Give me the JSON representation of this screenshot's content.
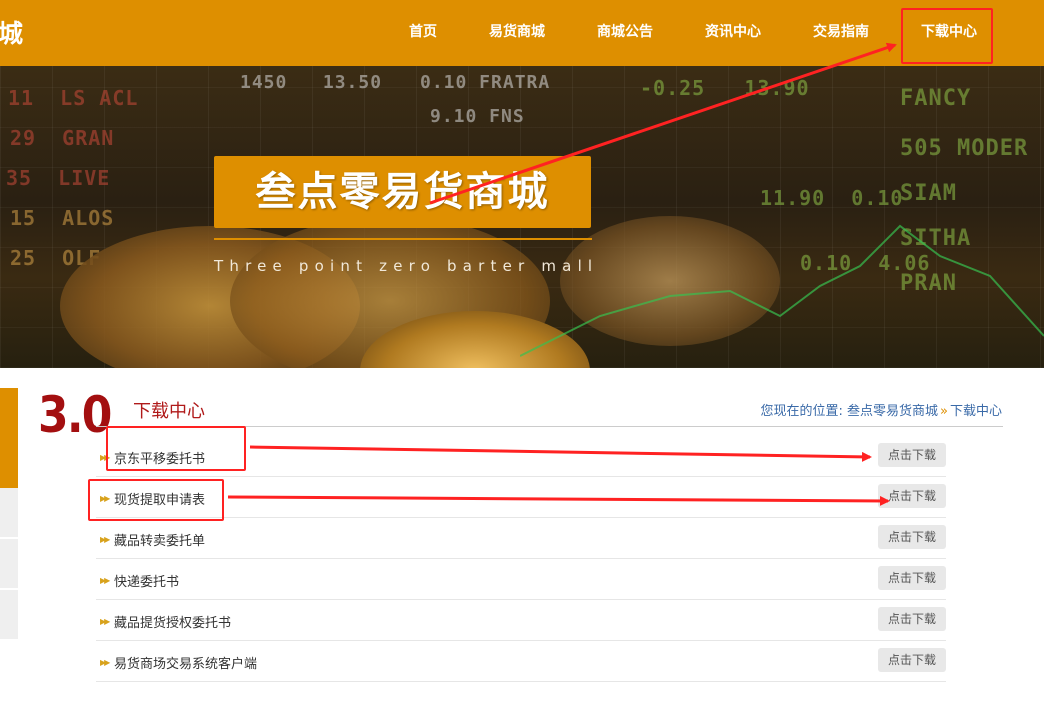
{
  "header": {
    "logo_fragment": "城",
    "nav": [
      {
        "label": "首页"
      },
      {
        "label": "易货商城"
      },
      {
        "label": "商城公告"
      },
      {
        "label": "资讯中心"
      },
      {
        "label": "交易指南"
      },
      {
        "label": "下载中心",
        "active": true
      }
    ]
  },
  "hero": {
    "title": "叁点零易货商城",
    "subtitle": "Three point zero barter mall"
  },
  "annotation": {
    "label": "3.0"
  },
  "content": {
    "section_title": "下载中心",
    "breadcrumb": {
      "prefix": "您现在的位置:",
      "site": "叁点零易货商城",
      "separator": "»",
      "current": "下载中心"
    },
    "downloads": [
      {
        "name": "京东平移委托书",
        "button": "点击下载"
      },
      {
        "name": "现货提取申请表",
        "button": "点击下载"
      },
      {
        "name": "藏品转卖委托单",
        "button": "点击下载"
      },
      {
        "name": "快递委托书",
        "button": "点击下载"
      },
      {
        "name": "藏品提货授权委托书",
        "button": "点击下载"
      },
      {
        "name": "易货商场交易系统客户端",
        "button": "点击下载"
      }
    ]
  },
  "colors": {
    "brand_orange": "#de8f00",
    "annotation_red": "#ff2222",
    "title_red": "#b01a1a"
  }
}
